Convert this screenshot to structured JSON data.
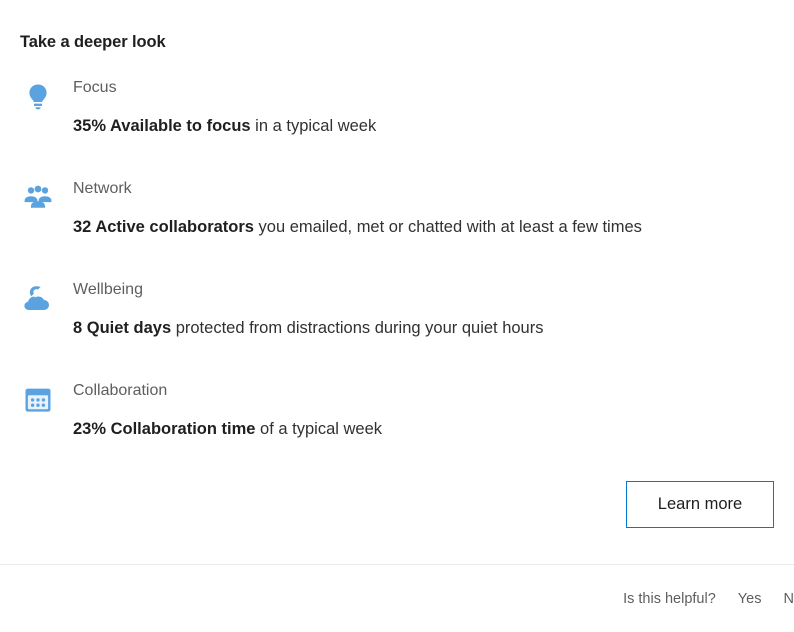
{
  "card": {
    "title": "Take a deeper look",
    "insights": [
      {
        "icon": "lightbulb-icon",
        "label": "Focus",
        "metric": "35% Available to focus",
        "description": " in a typical week"
      },
      {
        "icon": "people-group-icon",
        "label": "Network",
        "metric": "32 Active collaborators",
        "description": " you emailed, met or chatted with at least a few times"
      },
      {
        "icon": "moon-cloud-icon",
        "label": "Wellbeing",
        "metric": "8 Quiet days",
        "description": " protected from distractions during your quiet hours"
      },
      {
        "icon": "calendar-icon",
        "label": "Collaboration",
        "metric": "23% Collaboration time",
        "description": " of a typical week"
      }
    ],
    "learn_more_label": "Learn more"
  },
  "footer": {
    "feedback_question": "Is this helpful?",
    "yes_label": "Yes",
    "no_label": "No"
  },
  "colors": {
    "icon_blue": "#5ba3e0",
    "accent_blue": "#0078d4",
    "label_gray": "#605e5c",
    "text_dark": "#201f1e",
    "divider": "#edebe9"
  }
}
